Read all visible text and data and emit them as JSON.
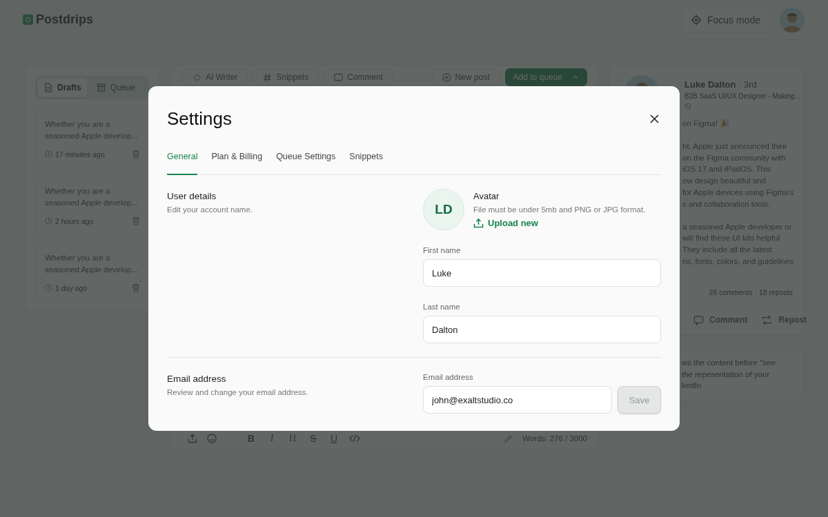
{
  "header": {
    "logo": "Postdrips",
    "focus_button": "Focus mode"
  },
  "drafts_panel": {
    "tabs": [
      {
        "label": "Drafts",
        "selected": true
      },
      {
        "label": "Queue",
        "selected": false
      }
    ],
    "drafts": [
      {
        "text": "Whether you are a seasoned Apple develop...",
        "time": "17 minutes ago"
      },
      {
        "text": "Whether you are a seasoned Apple develop...",
        "time": "2 hours ago"
      },
      {
        "text": "Whether you are a seasoned Apple develop...",
        "time": "1 day ago"
      }
    ]
  },
  "editor": {
    "tools": [
      {
        "label": "AI Writer",
        "kind": "ai"
      },
      {
        "label": "Snippets",
        "kind": "hash"
      },
      {
        "label": "Comment",
        "kind": "comment"
      }
    ],
    "new_post": "New post",
    "add_to_queue": "Add to queue",
    "format_buttons": [
      {
        "label": "B",
        "kind": "bold"
      },
      {
        "label": "I",
        "kind": "italic"
      },
      {
        "label": "H",
        "kind": "heading"
      },
      {
        "label": "S",
        "kind": "strike"
      },
      {
        "label": "U",
        "kind": "underline"
      }
    ],
    "word_count": "Words: 276 / 3000"
  },
  "preview": {
    "name": "Luke Dalton",
    "degree": "· 3rd",
    "headline": "B2B SaaS UI/UX Designer - Making...",
    "post_paragraphs": [
      [
        "on Figma! 🎉"
      ],
      [
        "ht. Apple just announced their",
        "on the Figma community with",
        "iOS 17 and iPadOS. This",
        "ow design beautiful and",
        "for Apple devices using Figma's",
        "s and collaboration tools."
      ],
      [
        "a seasoned Apple developer or",
        "will find these UI kits helpful",
        "They include all the latest",
        "ns, fonts, colors, and guidelines"
      ]
    ],
    "stats": "26 comments · 18 reposts",
    "actions": [
      {
        "label": "Comment",
        "kind": "comment"
      },
      {
        "label": "Repost",
        "kind": "repost"
      }
    ],
    "note_lines": [
      "ws the content before \"see",
      "the repesentation of your",
      "kedIn"
    ]
  },
  "settings": {
    "title": "Settings",
    "tabs": [
      {
        "label": "General",
        "selected": true
      },
      {
        "label": "Plan & Billing",
        "selected": false
      },
      {
        "label": "Queue Settings",
        "selected": false
      },
      {
        "label": "Snippets",
        "selected": false
      }
    ],
    "user_details": {
      "title": "User details",
      "description": "Edit your account name."
    },
    "avatar": {
      "initials": "LD",
      "title": "Avatar",
      "hint": "File must be under 5mb and PNG or JPG format.",
      "upload": "Upload new"
    },
    "first_name": {
      "label": "First name",
      "value": "Luke"
    },
    "last_name": {
      "label": "Last name",
      "value": "Dalton"
    },
    "email_section": {
      "title": "Email address",
      "description": "Review and change your email address."
    },
    "email": {
      "label": "Email address",
      "value": "john@exaltstudio.co"
    },
    "save": {
      "label": "Save",
      "disabled": true
    }
  }
}
